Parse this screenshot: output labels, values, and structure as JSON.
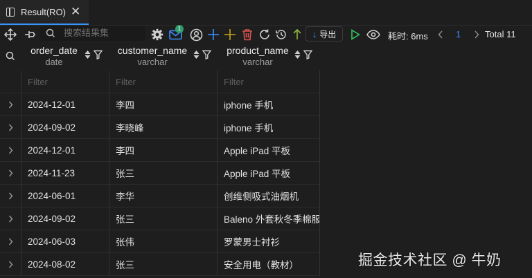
{
  "tab": {
    "title": "Result(RO)",
    "close": "✕"
  },
  "toolbar": {
    "search_placeholder": "搜索结果集",
    "badge": "1",
    "export_label": "导出",
    "elapsed": "耗时: 6ms",
    "page": "1",
    "total": "Total 11"
  },
  "columns": [
    {
      "name": "order_date",
      "type": "date"
    },
    {
      "name": "customer_name",
      "type": "varchar"
    },
    {
      "name": "product_name",
      "type": "varchar"
    }
  ],
  "filter_placeholder": "Filter",
  "rows": [
    [
      "2024-12-01",
      "李四",
      "iphone 手机"
    ],
    [
      "2024-09-02",
      "李晓峰",
      "iphone 手机"
    ],
    [
      "2024-12-01",
      "李四",
      "Apple iPad 平板"
    ],
    [
      "2024-11-23",
      "张三",
      "Apple iPad 平板"
    ],
    [
      "2024-06-01",
      "李华",
      "创维侧吸式油烟机"
    ],
    [
      "2024-09-02",
      "张三",
      "Baleno 外套秋冬季棉服"
    ],
    [
      "2024-06-03",
      "张伟",
      "罗蒙男士衬衫"
    ],
    [
      "2024-08-02",
      "张三",
      "安全用电（教材）"
    ]
  ],
  "watermark": "掘金技术社区 @ 牛奶"
}
